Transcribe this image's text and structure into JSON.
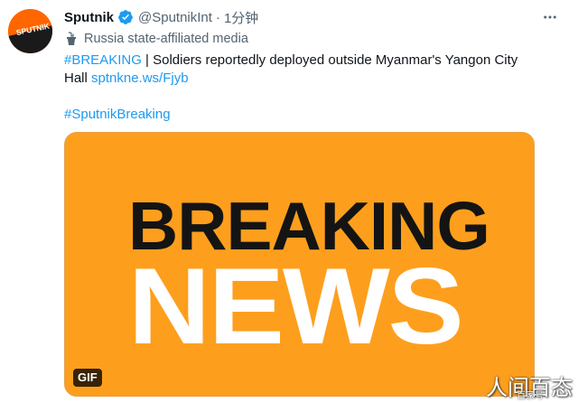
{
  "tweet": {
    "author_name": "Sputnik",
    "handle": "@SputnikInt",
    "separator": "·",
    "time": "1分钟",
    "affiliation_label": "Russia state-affiliated media",
    "avatar_text": "SPUTNIK",
    "text": {
      "hashtag_breaking": "#BREAKING",
      "pipe": " | ",
      "body_line1": "Soldiers reportedly deployed outside Myanmar's Yangon City",
      "body_line2": "Hall ",
      "link": "sptnkne.ws/Fjyb",
      "hashtag_sputnik": "#SputnikBreaking"
    },
    "media": {
      "headline_top": "BREAKING",
      "headline_bottom": "NEWS",
      "badge": "GIF"
    }
  },
  "watermark": {
    "big_text": "人间百态",
    "small_text": "百家号"
  },
  "colors": {
    "link": "#1d9bf0",
    "media_background": "#fd9f1d",
    "verified": "#1d9bf0",
    "avatar": "#ff6600"
  }
}
